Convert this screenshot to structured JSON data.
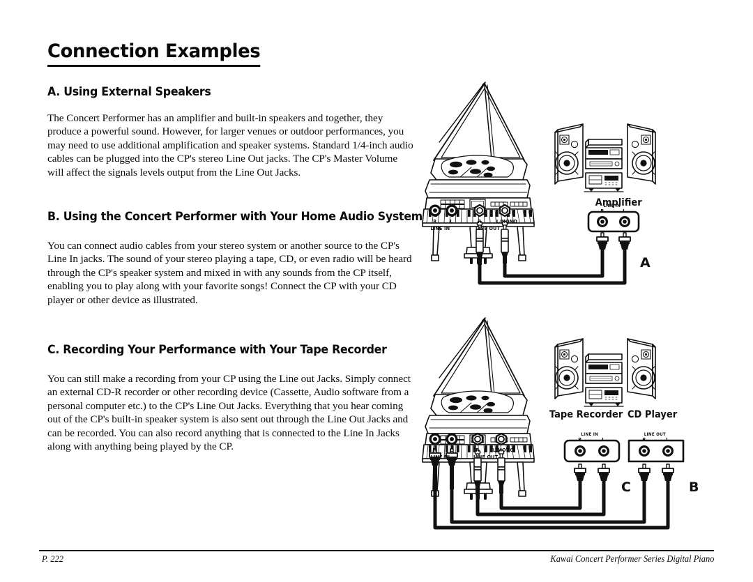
{
  "document": {
    "title": "Connection Examples",
    "sections": [
      {
        "heading": "A. Using External Speakers",
        "body": "The Concert Performer has an amplifier and built-in speakers and together, they produce a powerful sound. However, for larger venues or outdoor performances, you may need to use additional amplification and speaker systems.\nStandard 1/4-inch audio cables can be plugged into the CP's stereo Line Out jacks.  The CP's Master Volume will affect the signals levels output from the Line Out Jacks."
      },
      {
        "heading": "B. Using the Concert Performer with Your Home Audio System",
        "body": "You can connect audio cables from your stereo system or another source to the CP's Line In jacks.  The sound of your stereo playing a tape, CD, or even radio will be heard through the CP's speaker system and mixed in with any sounds from the CP itself, enabling you to play along with your favorite songs! Connect the CP with your CD player or other device as illustrated."
      },
      {
        "heading": "C. Recording Your Performance with Your Tape Recorder",
        "body": "You can still make a recording from your CP using the Line out Jacks.  Simply connect an external CD-R recorder or other recording device (Cassette, Audio software from a personal computer etc.) to the CP's Line Out Jacks.  Everything that you hear coming out of the CP's built-in speaker system is also sent out through the Line Out Jacks and can be recorded.  You can also record anything that is connected to the Line In Jacks along with anything being played by the CP."
      }
    ]
  },
  "footer": {
    "page_number": "P. 222",
    "series_line": "Kawai Concert Performer Series Digital Piano"
  },
  "diagram_a": {
    "device_label": "Amplifier",
    "connection_label": "A",
    "cp_panel": {
      "line_in_group": "LINE IN",
      "line_in_r": "R",
      "line_in_l": "L",
      "line_out_group": "LINE OUT",
      "line_out_r": "R",
      "line_out_l": "L/MONO"
    },
    "amp_panel": {
      "group": "LINE IN",
      "r": "R",
      "l": "L"
    }
  },
  "diagram_bc": {
    "tape_recorder_label": "Tape Recorder",
    "cd_player_label": "CD Player",
    "connection_label_c": "C",
    "connection_label_b": "B",
    "cp_panel": {
      "line_in_group": "LINE IN",
      "line_in_r": "R",
      "line_in_l": "L",
      "line_out_group": "LINE OUT",
      "line_out_r": "R",
      "line_out_l": "L/MONO"
    },
    "tape_panel": {
      "group": "LINE IN",
      "r": "R",
      "l": "L"
    },
    "cd_panel": {
      "group": "LINE OUT",
      "r": "R",
      "l": "L"
    }
  },
  "colors": {
    "ink": "#111111",
    "paper": "#ffffff"
  }
}
